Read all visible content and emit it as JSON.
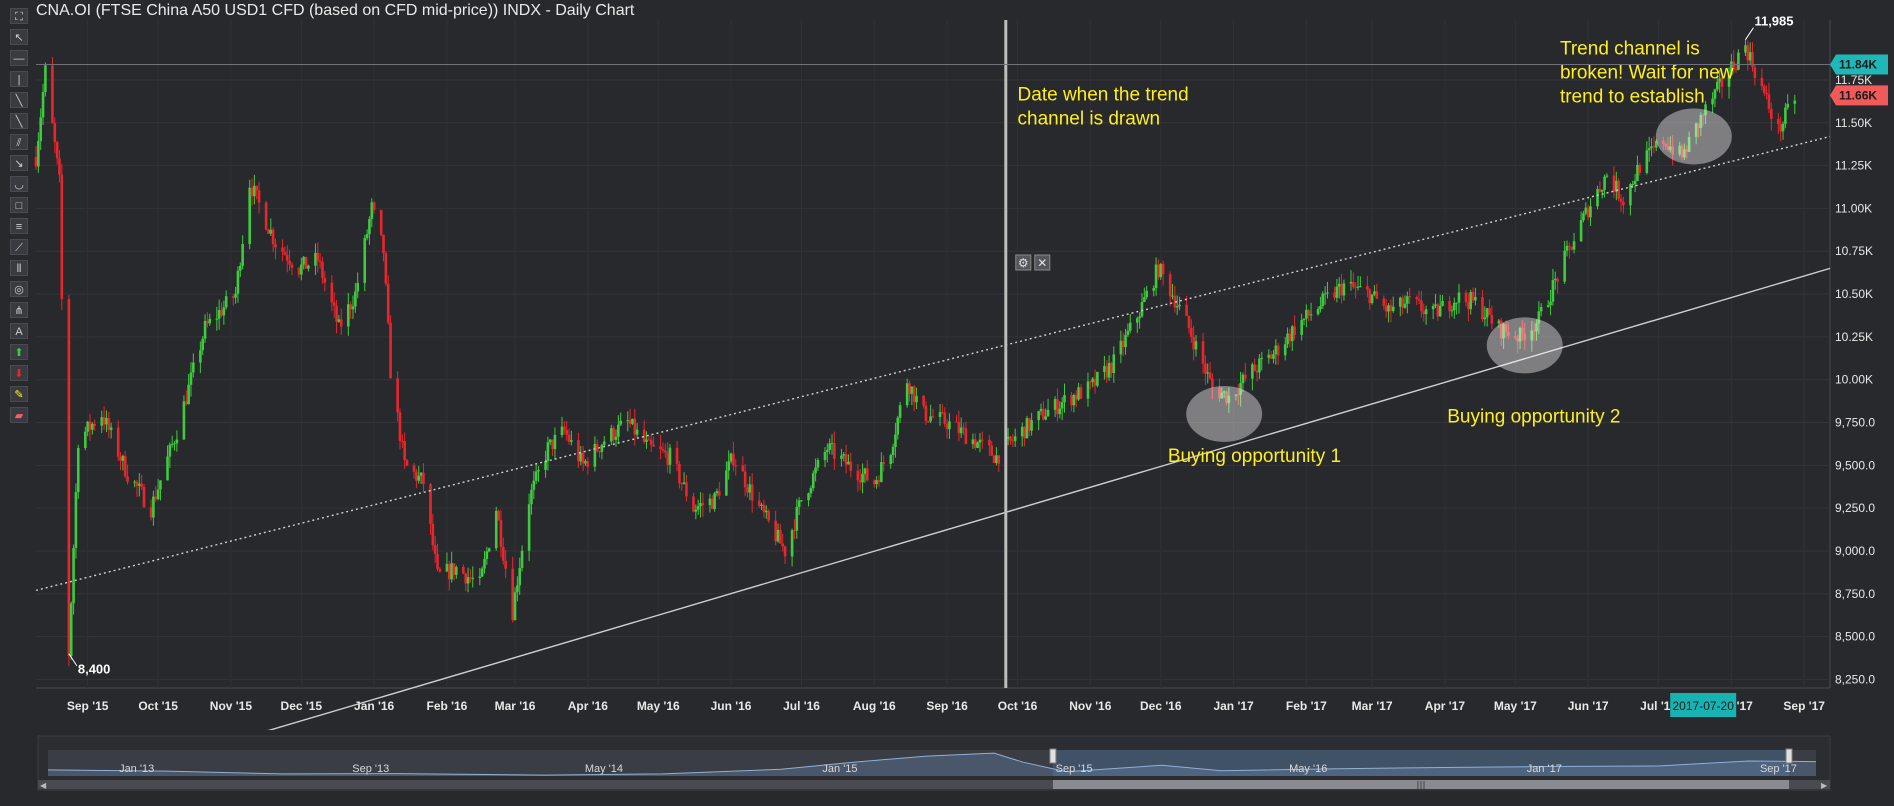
{
  "title": "CNA.OI (FTSE China A50 USD1 CFD (based on CFD mid-price)) INDX - Daily Chart",
  "toolbar": {
    "icons": [
      "expand-icon",
      "pointer-icon",
      "horizontal-line-icon",
      "vertical-line-icon",
      "diagonal-line-icon",
      "ray-icon",
      "parallel-channel-icon",
      "arrow-line-icon",
      "arc-icon",
      "rectangle-icon",
      "fibonacci-retracement-icon",
      "fan-icon",
      "time-zones-icon",
      "ellipse-icon",
      "andrews-pitchfork-icon",
      "text-icon",
      "buy-arrow-icon",
      "sell-arrow-icon",
      "highlighter-icon",
      "eraser-icon"
    ]
  },
  "colors": {
    "background": "#28292d",
    "up_candle": "#3ecb3e",
    "down_candle": "#e8262c",
    "annotation": "#ffee22",
    "price_tag_upper": "#1fb8b8",
    "price_tag_lower": "#f05a5a",
    "date_tag": "#17b3b3"
  },
  "chart_data": {
    "type": "candlestick",
    "title": "CNA.OI (FTSE China A50 USD1 CFD (based on CFD mid-price)) INDX - Daily Chart",
    "x_tick_labels": [
      "Sep '15",
      "Oct '15",
      "Nov '15",
      "Dec '15",
      "Jan '16",
      "Feb '16",
      "Mar '16",
      "Apr '16",
      "May '16",
      "Jun '16",
      "Jul '16",
      "Aug '16",
      "Sep '16",
      "Oct '16",
      "Nov '16",
      "Dec '16",
      "Jan '17",
      "Feb '17",
      "Mar '17",
      "Apr '17",
      "May '17",
      "Jun '17",
      "Jul '17",
      "Aug '17",
      "Sep '17"
    ],
    "y_tick_labels": [
      "8,250.0",
      "8,500.0",
      "8,750.0",
      "9,000.0",
      "9,250.0",
      "9,500.0",
      "9,750.0",
      "10.00K",
      "10.25K",
      "10.50K",
      "10.75K",
      "11.00K",
      "11.25K",
      "11.50K",
      "11.75K"
    ],
    "y_ticks": [
      8250,
      8500,
      8750,
      9000,
      9250,
      9500,
      9750,
      10000,
      10250,
      10500,
      10750,
      11000,
      11250,
      11500,
      11750
    ],
    "ylim": [
      8200,
      12100
    ],
    "xlim": [
      "2015-08-10",
      "2017-09-12"
    ],
    "grid": true,
    "series": [
      {
        "points": [
          [
            "2015-08-10",
            11300
          ],
          [
            "2015-08-14",
            11800
          ],
          [
            "2015-08-20",
            11150
          ],
          [
            "2015-08-24",
            8400
          ],
          [
            "2015-08-28",
            9650
          ],
          [
            "2015-09-07",
            9800
          ],
          [
            "2015-09-18",
            9450
          ],
          [
            "2015-09-28",
            9250
          ],
          [
            "2015-10-09",
            9700
          ],
          [
            "2015-10-21",
            10300
          ],
          [
            "2015-11-03",
            10500
          ],
          [
            "2015-11-09",
            11150
          ],
          [
            "2015-11-20",
            10800
          ],
          [
            "2015-11-30",
            10650
          ],
          [
            "2015-12-08",
            10700
          ],
          [
            "2015-12-17",
            10300
          ],
          [
            "2015-12-24",
            10500
          ],
          [
            "2015-12-31",
            11000
          ],
          [
            "2016-01-05",
            10750
          ],
          [
            "2016-01-08",
            10050
          ],
          [
            "2016-01-14",
            9500
          ],
          [
            "2016-01-22",
            9400
          ],
          [
            "2016-01-28",
            8850
          ],
          [
            "2016-02-05",
            8900
          ],
          [
            "2016-02-15",
            8800
          ],
          [
            "2016-02-22",
            9250
          ],
          [
            "2016-02-29",
            8650
          ],
          [
            "2016-03-07",
            9300
          ],
          [
            "2016-03-15",
            9600
          ],
          [
            "2016-03-22",
            9700
          ],
          [
            "2016-03-30",
            9500
          ],
          [
            "2016-04-08",
            9650
          ],
          [
            "2016-04-18",
            9750
          ],
          [
            "2016-04-27",
            9600
          ],
          [
            "2016-05-06",
            9550
          ],
          [
            "2016-05-16",
            9250
          ],
          [
            "2016-05-25",
            9300
          ],
          [
            "2016-06-02",
            9550
          ],
          [
            "2016-06-13",
            9250
          ],
          [
            "2016-06-24",
            9000
          ],
          [
            "2016-07-01",
            9300
          ],
          [
            "2016-07-12",
            9600
          ],
          [
            "2016-07-21",
            9500
          ],
          [
            "2016-08-01",
            9400
          ],
          [
            "2016-08-08",
            9600
          ],
          [
            "2016-08-15",
            10000
          ],
          [
            "2016-08-22",
            9800
          ],
          [
            "2016-09-01",
            9750
          ],
          [
            "2016-09-12",
            9650
          ],
          [
            "2016-09-22",
            9550
          ],
          [
            "2016-10-03",
            9700
          ],
          [
            "2016-10-12",
            9800
          ],
          [
            "2016-10-24",
            9900
          ],
          [
            "2016-11-01",
            9950
          ],
          [
            "2016-11-11",
            10100
          ],
          [
            "2016-11-22",
            10400
          ],
          [
            "2016-11-30",
            10650
          ],
          [
            "2016-12-06",
            10500
          ],
          [
            "2016-12-13",
            10300
          ],
          [
            "2016-12-23",
            9950
          ],
          [
            "2016-12-30",
            9900
          ],
          [
            "2017-01-09",
            10050
          ],
          [
            "2017-01-18",
            10150
          ],
          [
            "2017-01-27",
            10300
          ],
          [
            "2017-02-08",
            10450
          ],
          [
            "2017-02-17",
            10550
          ],
          [
            "2017-02-28",
            10500
          ],
          [
            "2017-03-08",
            10400
          ],
          [
            "2017-03-17",
            10450
          ],
          [
            "2017-03-27",
            10380
          ],
          [
            "2017-04-06",
            10480
          ],
          [
            "2017-04-14",
            10450
          ],
          [
            "2017-04-24",
            10300
          ],
          [
            "2017-05-03",
            10250
          ],
          [
            "2017-05-11",
            10350
          ],
          [
            "2017-05-22",
            10700
          ],
          [
            "2017-06-01",
            11000
          ],
          [
            "2017-06-09",
            11200
          ],
          [
            "2017-06-16",
            11050
          ],
          [
            "2017-06-23",
            11250
          ],
          [
            "2017-07-03",
            11400
          ],
          [
            "2017-07-11",
            11300
          ],
          [
            "2017-07-20",
            11550
          ],
          [
            "2017-07-31",
            11800
          ],
          [
            "2017-08-07",
            11950
          ],
          [
            "2017-08-14",
            11700
          ],
          [
            "2017-08-21",
            11450
          ],
          [
            "2017-08-28",
            11650
          ]
        ]
      }
    ],
    "lines": [
      {
        "from": [
          "2015-08-10",
          8770
        ],
        "to": [
          "2017-09-12",
          11420
        ],
        "style": "dotted"
      },
      {
        "from": [
          "2015-08-10",
          7550
        ],
        "to": [
          "2017-09-12",
          10650
        ],
        "style": "solid"
      }
    ],
    "vertical_marker": "2016-09-26",
    "ellipses": [
      {
        "center": [
          "2016-12-28",
          9800
        ]
      },
      {
        "center": [
          "2017-05-05",
          10200
        ]
      },
      {
        "center": [
          "2017-07-16",
          11420
        ]
      }
    ],
    "extremes": [
      {
        "date": "2015-08-24",
        "value": 8400,
        "label": "8,400",
        "position": "below"
      },
      {
        "date": "2017-08-07",
        "value": 11985,
        "label": "11,985",
        "position": "above"
      }
    ],
    "annotations": [
      {
        "text": "Date when the trend channel is drawn",
        "lines": [
          "Date when the trend",
          "channel is drawn"
        ],
        "at": [
          "2016-10-01",
          11630
        ]
      },
      {
        "text": "Buying opportunity 1",
        "lines": [
          "Buying opportunity 1"
        ],
        "at": [
          "2016-12-04",
          9520
        ]
      },
      {
        "text": "Buying opportunity 2",
        "lines": [
          "Buying opportunity 2"
        ],
        "at": [
          "2017-04-02",
          9750
        ]
      },
      {
        "text": "Trend channel is broken! Wait for new trend to establish",
        "lines": [
          "Trend channel is",
          "broken! Wait for new",
          "trend to establish"
        ],
        "at": [
          "2017-05-20",
          11900
        ]
      }
    ],
    "price_tags": [
      {
        "label": "11.84K",
        "value": 11840,
        "color": "#1fb8b8"
      },
      {
        "label": "11.66K",
        "value": 11660,
        "color": "#f05a5a"
      }
    ],
    "crosshair_date_label": "2017-07-20"
  },
  "navigator": {
    "labels": [
      "Jan '13",
      "Sep '13",
      "May '14",
      "Jan '15",
      "Sep '15",
      "May '16",
      "Jan '17",
      "Sep '17"
    ],
    "label_dates": [
      "2013-01-01",
      "2013-09-01",
      "2014-05-01",
      "2015-01-01",
      "2015-09-01",
      "2016-05-01",
      "2017-01-01",
      "2017-09-01"
    ],
    "range": [
      "2012-10-01",
      "2017-10-10"
    ],
    "window": [
      "2015-08-10",
      "2017-09-12"
    ],
    "overview": [
      [
        "2012-10-01",
        9000
      ],
      [
        "2013-02-01",
        8600
      ],
      [
        "2013-06-01",
        7700
      ],
      [
        "2013-10-01",
        7800
      ],
      [
        "2014-03-01",
        7300
      ],
      [
        "2014-07-01",
        7700
      ],
      [
        "2014-11-01",
        9200
      ],
      [
        "2015-01-15",
        11500
      ],
      [
        "2015-04-01",
        13500
      ],
      [
        "2015-06-10",
        14500
      ],
      [
        "2015-07-10",
        11500
      ],
      [
        "2015-08-24",
        8400
      ],
      [
        "2015-12-01",
        10500
      ],
      [
        "2016-02-01",
        8700
      ],
      [
        "2016-06-01",
        9400
      ],
      [
        "2016-10-01",
        9800
      ],
      [
        "2017-01-01",
        10100
      ],
      [
        "2017-05-01",
        10300
      ],
      [
        "2017-08-01",
        11900
      ],
      [
        "2017-10-10",
        11700
      ]
    ]
  }
}
